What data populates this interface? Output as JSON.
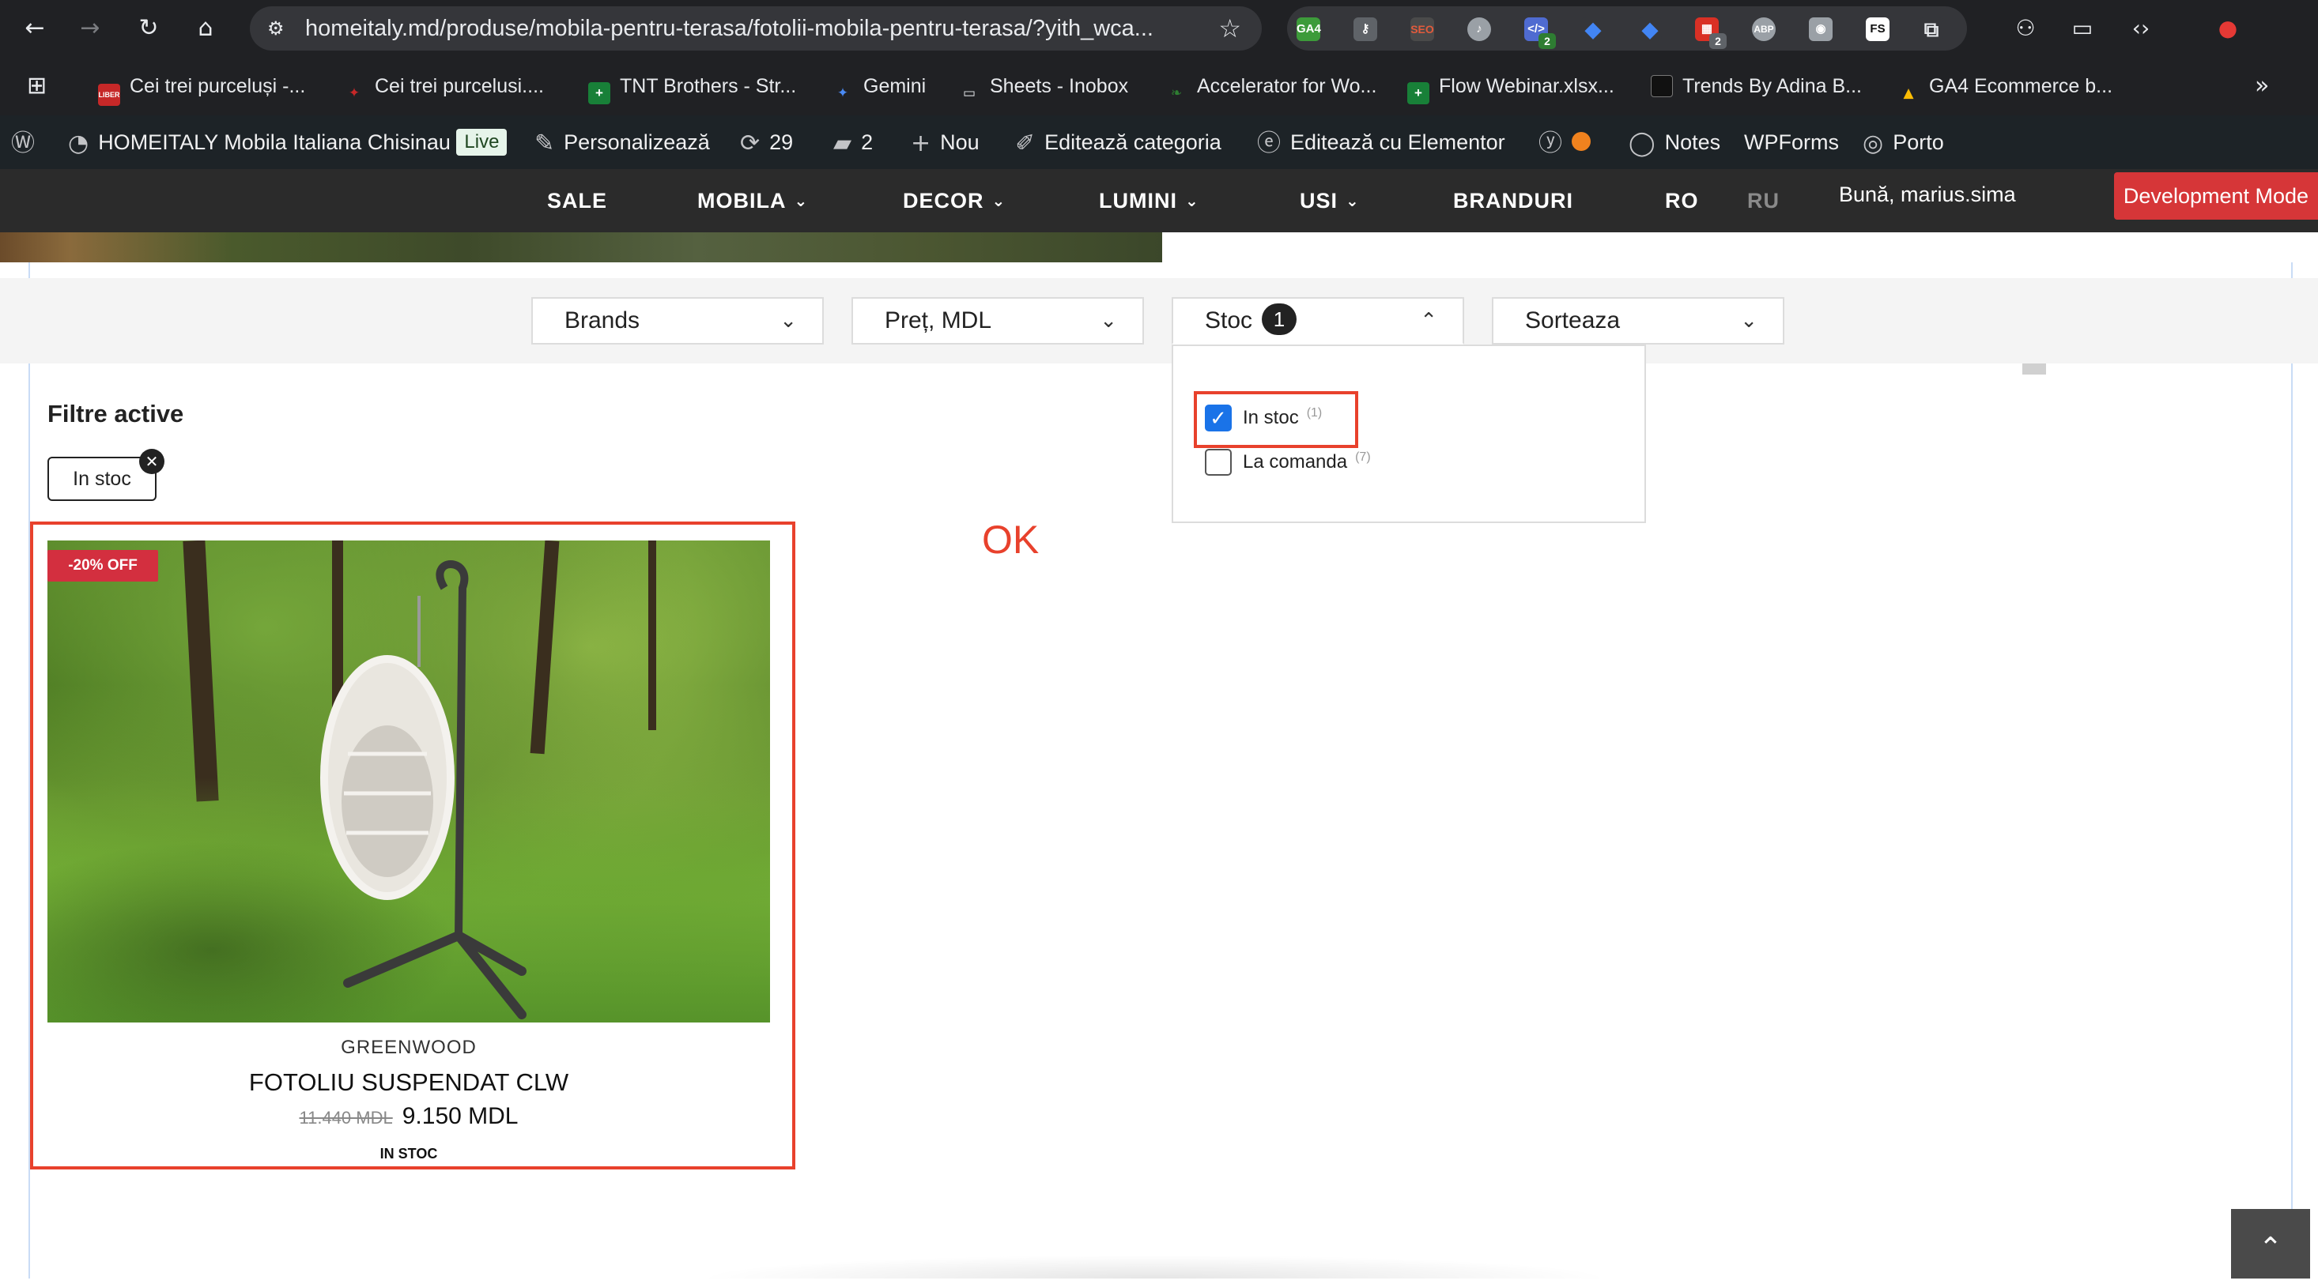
{
  "browser": {
    "url": "homeitaly.md/produse/mobila-pentru-terasa/fotolii-mobila-pentru-terasa/?yith_wca...",
    "extensions": [
      "GA4",
      "SEO",
      "ABP",
      "FS"
    ],
    "ext_badges": [
      "2",
      "2"
    ]
  },
  "bookmarks": [
    {
      "label": "Cei trei purceluși -...",
      "icon": "LIBER"
    },
    {
      "label": "Cei trei purcelusi....",
      "icon": "leaf"
    },
    {
      "label": "TNT Brothers - Str...",
      "icon": "sheets"
    },
    {
      "label": "Gemini",
      "icon": "gemini"
    },
    {
      "label": "Sheets - Inobox",
      "icon": "folder"
    },
    {
      "label": "Accelerator for Wo...",
      "icon": "accelerator"
    },
    {
      "label": "Flow Webinar.xlsx...",
      "icon": "sheets"
    },
    {
      "label": "Trends By Adina B...",
      "icon": "trends"
    },
    {
      "label": "GA4 Ecommerce b...",
      "icon": "drive"
    }
  ],
  "wpbar": {
    "site_name": "HOMEITALY Mobila Italiana Chisinau",
    "live": "Live",
    "customize": "Personalizează",
    "updates": "29",
    "comments": "2",
    "new": "Nou",
    "edit_category": "Editează categoria",
    "elementor": "Editează cu Elementor",
    "notes": "Notes",
    "wpforms": "WPForms",
    "porto": "Porto"
  },
  "nav": {
    "items": [
      "SALE",
      "MOBILA",
      "DECOR",
      "LUMINI",
      "USI",
      "BRANDURI"
    ],
    "lang_ro": "RO",
    "lang_ru": "RU",
    "greeting": "Bună, marius.sima",
    "dev_mode": "Development Mode"
  },
  "filters": {
    "brands": "Brands",
    "price": "Preț, MDL",
    "stock": "Stoc",
    "stock_count": "1",
    "sort": "Sorteaza",
    "options": [
      {
        "label": "In stoc",
        "count": "(1)",
        "checked": true
      },
      {
        "label": "La comanda",
        "count": "(7)",
        "checked": false
      }
    ]
  },
  "active_filters": {
    "title": "Filtre active",
    "chip": "In stoc"
  },
  "product": {
    "badge": "-20% OFF",
    "brand": "GREENWOOD",
    "name": "FOTOLIU SUSPENDAT CLW",
    "old_price": "11.440 MDL",
    "price": "9.150 MDL",
    "stock": "IN STOC"
  },
  "annotation": {
    "note": "OK",
    "color": "#e8412c"
  }
}
